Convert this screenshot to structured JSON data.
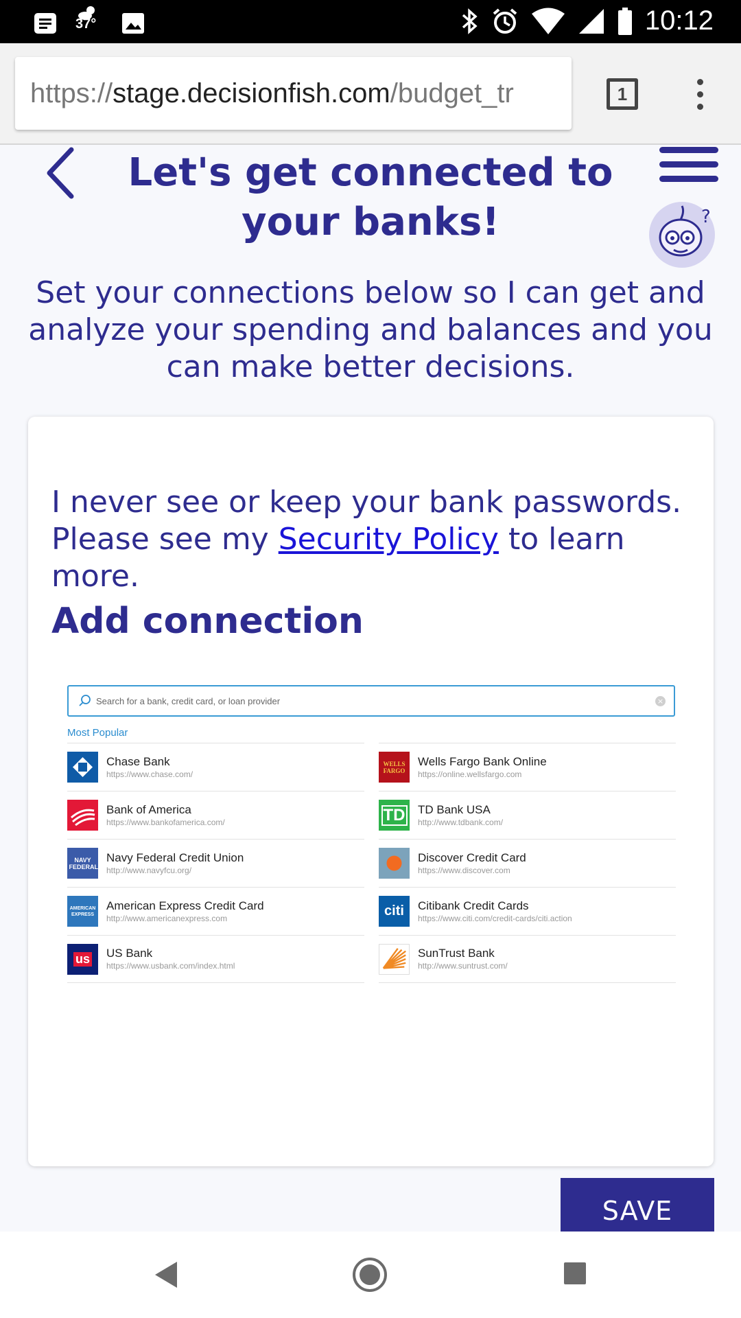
{
  "status_bar": {
    "time": "10:12",
    "temperature": "37°",
    "icons": [
      "notification-icon",
      "weather-icon",
      "image-icon",
      "bluetooth-icon",
      "alarm-icon",
      "wifi-icon",
      "signal-icon",
      "battery-icon"
    ]
  },
  "browser": {
    "url_scheme": "https://",
    "url_host": "stage.decisionfish.com",
    "url_path": "/budget_tr",
    "tab_count": "1"
  },
  "header": {
    "title": "Let's get connected to your banks!",
    "intro": "Set your connections below so I can get and analyze your spending and balances and you can make better decisions."
  },
  "card": {
    "privacy_before": "I never see or keep your bank passwords. Please see my ",
    "privacy_link": "Security Policy",
    "privacy_after": " to learn more.",
    "add_connection": "Add connection",
    "search_placeholder": "Search for a bank, credit card, or loan provider",
    "most_popular": "Most Popular"
  },
  "banks_left": [
    {
      "name": "Chase Bank",
      "url": "https://www.chase.com/",
      "logo": "chase-logo",
      "color": "#0f5ba7"
    },
    {
      "name": "Bank of America",
      "url": "https://www.bankofamerica.com/",
      "logo": "bank-of-america-logo",
      "color": "#e31837"
    },
    {
      "name": "Navy Federal Credit Union",
      "url": "http://www.navyfcu.org/",
      "logo": "navy-federal-logo",
      "color": "#3b5ba9"
    },
    {
      "name": "American Express Credit Card",
      "url": "http://www.americanexpress.com",
      "logo": "american-express-logo",
      "color": "#2e77bc"
    },
    {
      "name": "US Bank",
      "url": "https://www.usbank.com/index.html",
      "logo": "us-bank-logo",
      "color": "#0c2074"
    }
  ],
  "banks_right": [
    {
      "name": "Wells Fargo Bank Online",
      "url": "https://online.wellsfargo.com",
      "logo": "wells-fargo-logo",
      "color": "#b5121b"
    },
    {
      "name": "TD Bank USA",
      "url": "http://www.tdbank.com/",
      "logo": "td-bank-logo",
      "color": "#2db34a"
    },
    {
      "name": "Discover Credit Card",
      "url": "https://www.discover.com",
      "logo": "discover-logo",
      "color": "#7ca3bb"
    },
    {
      "name": "Citibank Credit Cards",
      "url": "https://www.citi.com/credit-cards/citi.action",
      "logo": "citibank-logo",
      "color": "#0a5ea8"
    },
    {
      "name": "SunTrust Bank",
      "url": "http://www.suntrust.com/",
      "logo": "suntrust-logo",
      "color": "#f08a24"
    }
  ],
  "logo_text": {
    "wells_fargo": "WELLS FARGO",
    "td": "TD",
    "navy": "NAVY FEDERAL",
    "amex": "AMERICAN EXPRESS",
    "citi": "citi",
    "us": "us"
  },
  "actions": {
    "save": "SAVE"
  },
  "colors": {
    "brand": "#2e2c8f",
    "link": "#1a14d8",
    "search_border": "#3a9bd5",
    "accent_label": "#2a8ccf"
  }
}
